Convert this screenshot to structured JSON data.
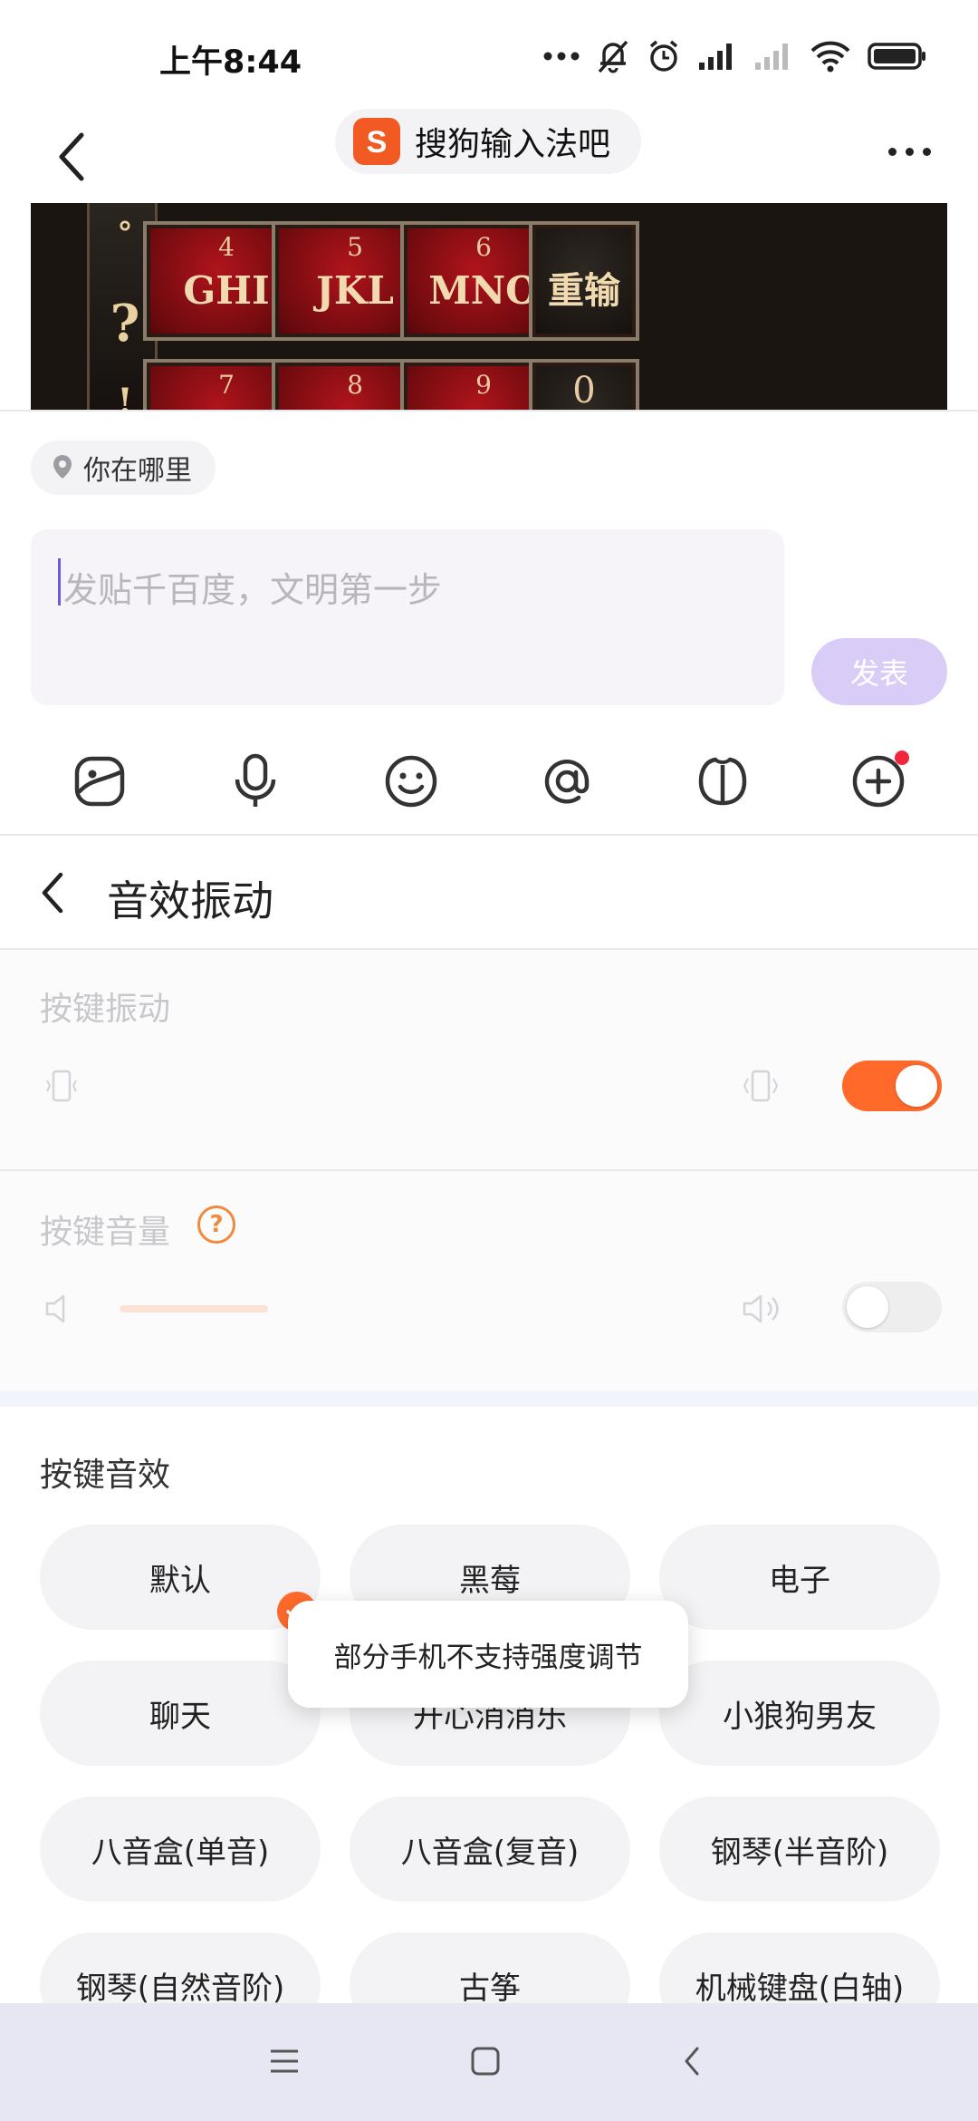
{
  "status_bar": {
    "time": "上午8:44",
    "icons": [
      "more-dots-icon",
      "silent-bell-icon",
      "alarm-icon",
      "signal-icon",
      "signal-weak-icon",
      "wifi-icon",
      "battery-icon"
    ]
  },
  "header": {
    "forum_name": "搜狗输入法吧",
    "forum_logo_letter": "S"
  },
  "image_strip": {
    "symbols": [
      "°",
      "?",
      "!"
    ],
    "keys": [
      {
        "num": "4",
        "letters": "GHI"
      },
      {
        "num": "5",
        "letters": "JKL"
      },
      {
        "num": "6",
        "letters": "MNO"
      },
      {
        "num": "",
        "letters": "重输"
      },
      {
        "num": "7",
        "letters": ""
      },
      {
        "num": "8",
        "letters": ""
      },
      {
        "num": "9",
        "letters": ""
      },
      {
        "num": "0",
        "letters": ""
      }
    ]
  },
  "location": {
    "label": "你在哪里"
  },
  "composer": {
    "placeholder": "发贴千百度，文明第一步",
    "post_label": "发表"
  },
  "toolbar": {
    "items": [
      "image-icon",
      "microphone-icon",
      "emoji-icon",
      "mention-icon",
      "gift-icon",
      "add-more-icon"
    ],
    "has_badge_on_last": true
  },
  "panel": {
    "title": "音效振动",
    "vibration_label": "按键振动",
    "vibration_enabled": true,
    "volume_label": "按键音量",
    "volume_enabled": false,
    "sound_title": "按键音效",
    "sounds": [
      "默认",
      "黑莓",
      "电子",
      "聊天",
      "开心消消乐",
      "小狼狗男友",
      "八音盒(单音)",
      "八音盒(复音)",
      "钢琴(半音阶)",
      "钢琴(自然音阶)",
      "古筝",
      "机械键盘(白轴)"
    ],
    "selected_sound": "默认"
  },
  "toast": {
    "message": "部分手机不支持强度调节"
  },
  "colors": {
    "accent": "#ff6a2b",
    "post_button": "#d9cdf8",
    "caret": "#6a5cd6",
    "badge": "#f0263a",
    "nav_bar": "#e6e7f3"
  }
}
